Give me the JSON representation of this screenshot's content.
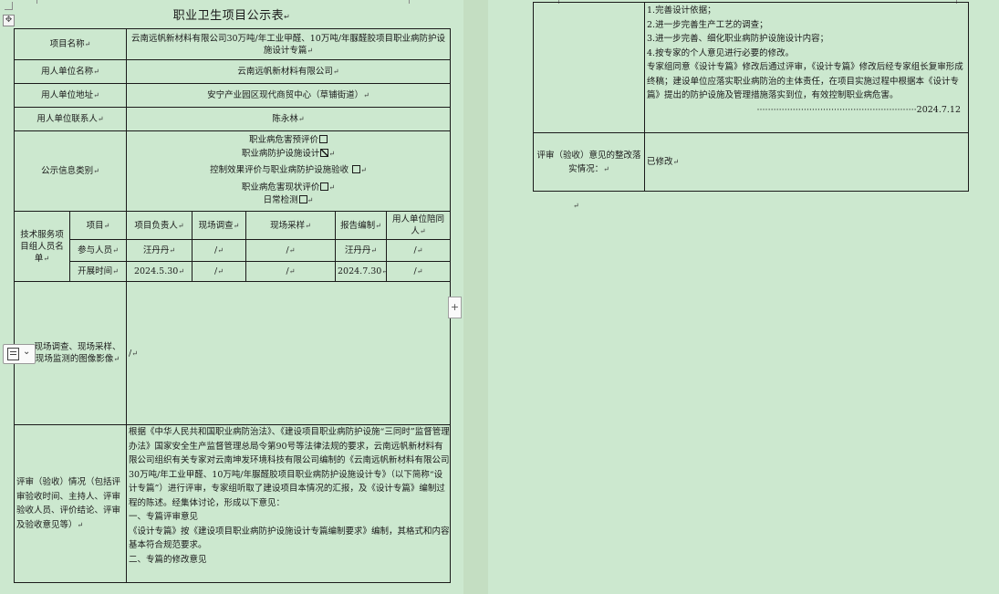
{
  "document": {
    "title": "职业卫生项目公示表",
    "labels": {
      "project_name": "项目名称",
      "employer_name": "用人单位名称",
      "employer_address": "用人单位地址",
      "employer_contact": "用人单位联系人",
      "info_category": "公示信息类别",
      "team": "技术服务项目组人员名单",
      "images": "现场调查、现场采样、现场监测的图像影像",
      "review": "评审（验收）情况（包括评审验收时间、主持人、评审验收人员、评价结论、评审及验收意见等）",
      "rectification": "评审（验收）意见的整改落实情况："
    },
    "values": {
      "project_name": "云南远帆新材料有限公司30万吨/年工业甲醛、10万吨/年脲醛胶项目职业病防护设施设计专篇",
      "employer_name": "云南远帆新材料有限公司",
      "employer_address": "安宁产业园区现代商贸中心（草铺街道）",
      "employer_contact": "陈永林",
      "images": "/",
      "rectification": "已修改"
    },
    "categories": [
      {
        "label": "职业病危害预评价",
        "checked": false
      },
      {
        "label": "职业病防护设施设计",
        "checked": true
      },
      {
        "label": "控制效果评价与职业病防护设施验收",
        "checked": false
      },
      {
        "label": "职业病危害现状评价",
        "checked": false
      },
      {
        "label": "日常检测",
        "checked": false
      }
    ],
    "team_table": {
      "headers": [
        "项目",
        "项目负责人",
        "现场调查",
        "现场采样",
        "报告编制",
        "用人单位陪同人"
      ],
      "rows": [
        [
          "参与人员",
          "汪丹丹",
          "/",
          "/",
          "汪丹丹",
          "/"
        ],
        [
          "开展时间",
          "2024.5.30",
          "/",
          "/",
          "2024.7.30",
          "/"
        ]
      ]
    },
    "review_text": [
      "根据《中华人民共和国职业病防治法》、《建设项目职业病防护设施“三同时”监督管理办法》国家安全生产监督管理总局令第90号等法律法规的要求，云南远帆新材料有限公司组织有关专家对云南坤发环境科技有限公司编制的《云南远帆新材料有限公司30万吨/年工业甲醛、10万吨/年脲醛胶项目职业病防护设施设计专》（以下简称“设计专篇”）进行评审，专家组听取了建设项目本情况的汇报，及《设计专篇》编制过程的陈述。经集体讨论，形成以下意见：",
      "一、专篇评审意见",
      "《设计专篇》按《建设项目职业病防护设施设计专篇编制要求》编制，其格式和内容基本符合规范要求。",
      "二、专篇的修改意见"
    ],
    "review_continued": [
      "1.完善设计依据；",
      "2.进一步完善生产工艺的调查；",
      "3.进一步完善、细化职业病防护设施设计内容；",
      "4.按专家的个人意见进行必要的修改。",
      "专家组同意《设计专篇》修改后通过评审，《设计专篇》修改后经专家组长复审形成终稿；建设单位应落实职业病防治的主体责任，在项目实施过程中根据本《设计专篇》提出的防护设施及管理措施落实到位，有效控制职业病危害。"
    ],
    "date_line": "··························································2024.7.12"
  }
}
